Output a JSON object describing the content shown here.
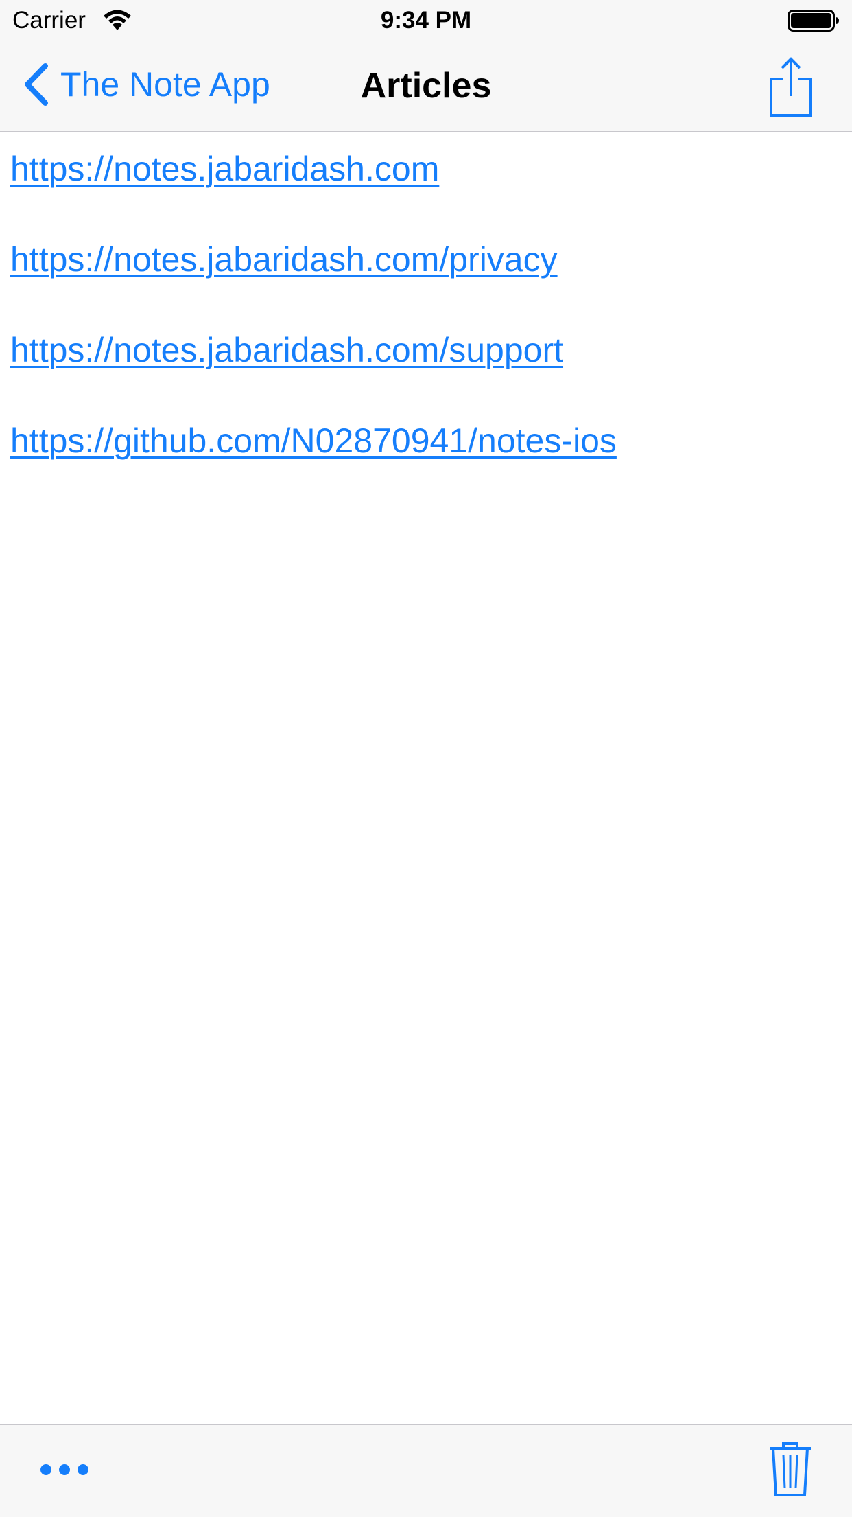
{
  "status_bar": {
    "carrier": "Carrier",
    "time": "9:34 PM"
  },
  "nav": {
    "back_label": "The Note App",
    "title": "Articles",
    "share_icon": "share-icon",
    "back_icon": "chevron-left-icon"
  },
  "links": [
    "https://notes.jabaridash.com",
    "https://notes.jabaridash.com/privacy",
    "https://notes.jabaridash.com/support",
    "https://github.com/N02870941/notes-ios"
  ],
  "toolbar": {
    "more_icon": "more-icon",
    "trash_icon": "trash-icon"
  },
  "colors": {
    "tint": "#157efb",
    "bar_background": "#f7f7f7",
    "separator": "#c8c7cc"
  }
}
